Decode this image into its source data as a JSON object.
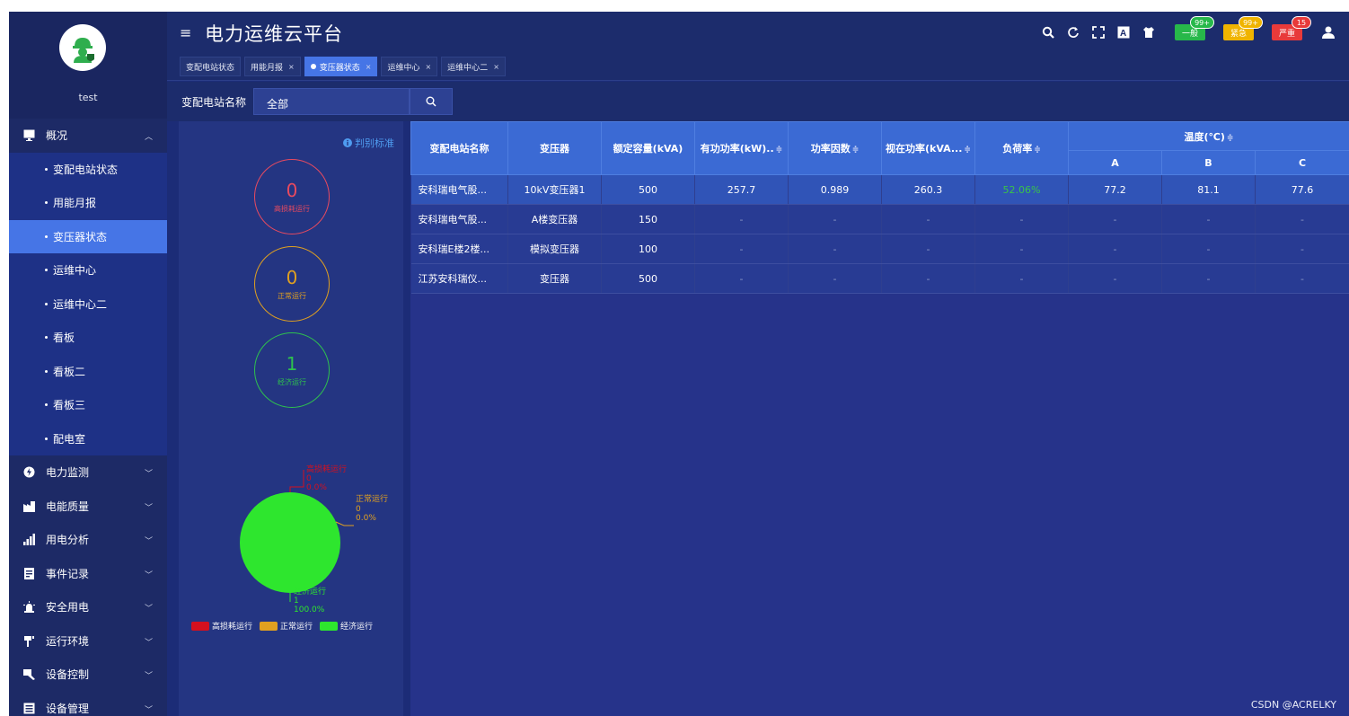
{
  "app": {
    "title": "电力运维云平台",
    "user": "test"
  },
  "header": {
    "tabs": [
      {
        "label": "变配电站状态",
        "closable": false,
        "active": false
      },
      {
        "label": "用能月报",
        "closable": true,
        "active": false
      },
      {
        "label": "变压器状态",
        "closable": true,
        "active": true
      },
      {
        "label": "运维中心",
        "closable": true,
        "active": false
      },
      {
        "label": "运维中心二",
        "closable": true,
        "active": false
      }
    ],
    "tools": [
      "search-icon",
      "refresh-icon",
      "fullscreen-icon",
      "translate-icon",
      "theme-icon"
    ],
    "alarms": [
      {
        "label": "一般",
        "badge": "99+",
        "color": "#27b84a"
      },
      {
        "label": "紧急",
        "badge": "99+",
        "color": "#f0b400"
      },
      {
        "label": "严重",
        "badge": "15",
        "color": "#e83a3a"
      }
    ]
  },
  "sidebar": {
    "groups": [
      {
        "label": "概况",
        "icon": "monitor-icon",
        "expanded": true,
        "items": [
          "变配电站状态",
          "用能月报",
          "变压器状态",
          "运维中心",
          "运维中心二",
          "看板",
          "看板二",
          "看板三",
          "配电室"
        ],
        "active_index": 2
      },
      {
        "label": "电力监测",
        "icon": "power-icon",
        "expanded": false
      },
      {
        "label": "电能质量",
        "icon": "factory-icon",
        "expanded": false
      },
      {
        "label": "用电分析",
        "icon": "signal-icon",
        "expanded": false
      },
      {
        "label": "事件记录",
        "icon": "record-icon",
        "expanded": false
      },
      {
        "label": "安全用电",
        "icon": "alarm-light-icon",
        "expanded": false
      },
      {
        "label": "运行环境",
        "icon": "environment-icon",
        "expanded": false
      },
      {
        "label": "设备控制",
        "icon": "control-icon",
        "expanded": false
      },
      {
        "label": "设备管理",
        "icon": "device-icon",
        "expanded": false
      }
    ]
  },
  "filter": {
    "label": "变配电站名称",
    "value": "全部"
  },
  "stats": {
    "criteria_label": "判别标准",
    "circles": [
      {
        "value": "0",
        "label": "高损耗运行",
        "color": "#e84a5f"
      },
      {
        "value": "0",
        "label": "正常运行",
        "color": "#e0a020"
      },
      {
        "value": "1",
        "label": "经济运行",
        "color": "#2ec14e"
      }
    ]
  },
  "chart_data": {
    "type": "pie",
    "slices": [
      {
        "name": "高损耗运行",
        "value": 0,
        "percent": "0.0%",
        "color": "#d4101e"
      },
      {
        "name": "正常运行",
        "value": 0,
        "percent": "0.0%",
        "color": "#e0a020"
      },
      {
        "name": "经济运行",
        "value": 1,
        "percent": "100.0%",
        "color": "#2ee62e"
      }
    ],
    "legend": [
      "高损耗运行",
      "正常运行",
      "经济运行"
    ],
    "legend_position": "bottom"
  },
  "table": {
    "headers": [
      "变配电站名称",
      "变压器",
      "额定容量(kVA)",
      "有功功率(kW)..",
      "功率因数",
      "视在功率(kVA...",
      "负荷率",
      "温度(℃)"
    ],
    "temp_sub": [
      "A",
      "B",
      "C"
    ],
    "rows": [
      [
        "安科瑞电气股...",
        "10kV变压器1",
        "500",
        "257.7",
        "0.989",
        "260.3",
        "52.06%",
        "77.2",
        "81.1",
        "77.6"
      ],
      [
        "安科瑞电气股...",
        "A楼变压器",
        "150",
        "-",
        "-",
        "-",
        "-",
        "-",
        "-",
        "-"
      ],
      [
        "安科瑞E楼2楼...",
        "模拟变压器",
        "100",
        "-",
        "-",
        "-",
        "-",
        "-",
        "-",
        "-"
      ],
      [
        "江苏安科瑞仪...",
        "变压器",
        "500",
        "-",
        "-",
        "-",
        "-",
        "-",
        "-",
        "-"
      ]
    ],
    "load_rate_color": "#39c34a"
  },
  "watermark": "CSDN @ACRELKY"
}
